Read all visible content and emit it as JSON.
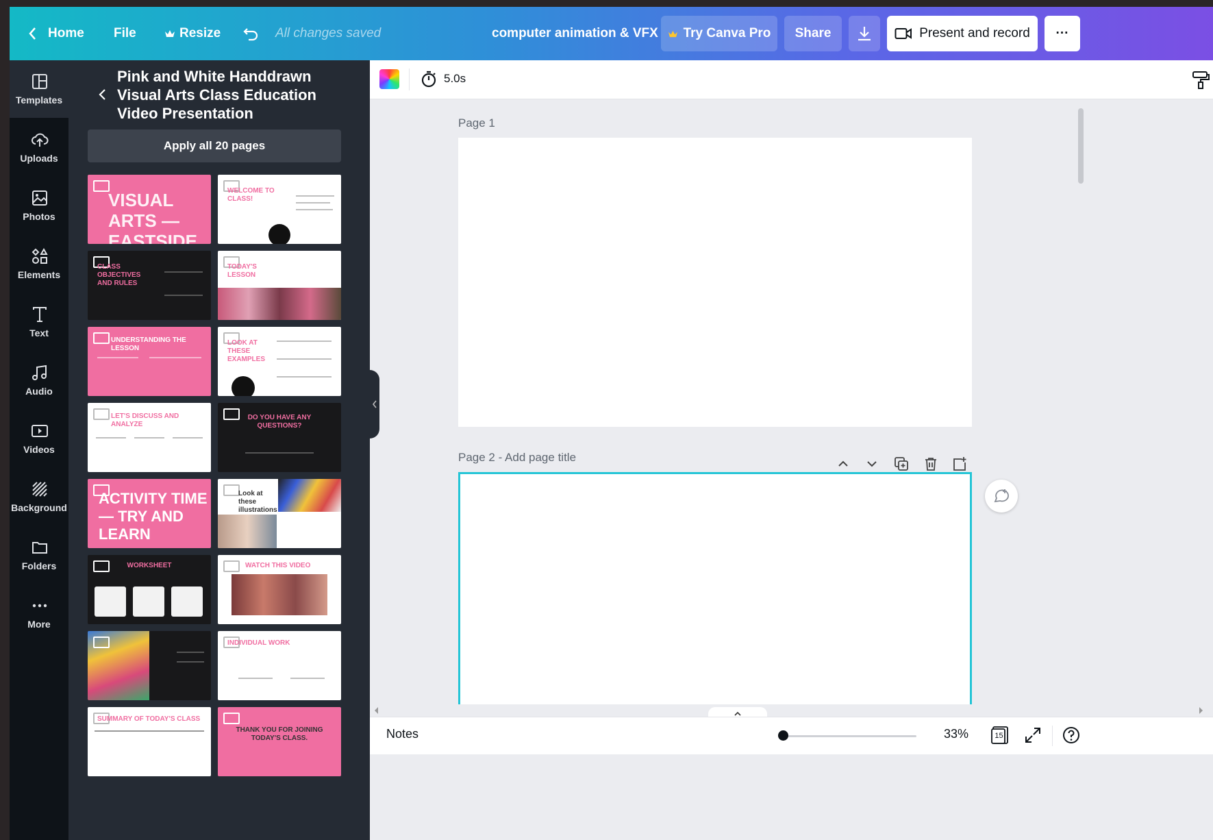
{
  "topbar": {
    "home_label": "Home",
    "file_label": "File",
    "resize_label": "Resize",
    "saved_status": "All changes saved",
    "doc_title": "computer animation & VFX",
    "try_pro_label": "Try Canva Pro",
    "share_label": "Share",
    "present_label": "Present and record",
    "more_label": "···"
  },
  "rail": {
    "items": [
      {
        "label": "Templates",
        "icon": "templates-icon"
      },
      {
        "label": "Uploads",
        "icon": "uploads-icon"
      },
      {
        "label": "Photos",
        "icon": "photos-icon"
      },
      {
        "label": "Elements",
        "icon": "elements-icon"
      },
      {
        "label": "Text",
        "icon": "text-icon"
      },
      {
        "label": "Audio",
        "icon": "audio-icon"
      },
      {
        "label": "Videos",
        "icon": "videos-icon"
      },
      {
        "label": "Background",
        "icon": "background-icon"
      },
      {
        "label": "Folders",
        "icon": "folders-icon"
      },
      {
        "label": "More",
        "icon": "more-icon"
      }
    ]
  },
  "panel": {
    "template_title": "Pink and White Handdrawn Visual Arts Class Education Video Presentation",
    "apply_label": "Apply all 20 pages",
    "thumbs": [
      {
        "text": "VISUAL ARTS — EASTSIDE LEARNING ACADEMY"
      },
      {
        "text": "WELCOME TO CLASS!"
      },
      {
        "text": "CLASS OBJECTIVES AND RULES"
      },
      {
        "text": "TODAY'S LESSON"
      },
      {
        "text": "UNDERSTANDING THE LESSON"
      },
      {
        "text": "LOOK AT THESE EXAMPLES"
      },
      {
        "text": "LET'S DISCUSS AND ANALYZE"
      },
      {
        "text": "DO YOU HAVE ANY QUESTIONS?"
      },
      {
        "text": "ACTIVITY TIME — TRY AND LEARN"
      },
      {
        "text": "Look at these illustrations"
      },
      {
        "text": "WORKSHEET"
      },
      {
        "text": "WATCH THIS VIDEO"
      },
      {
        "text": ""
      },
      {
        "text": "INDIVIDUAL WORK"
      },
      {
        "text": "SUMMARY OF TODAY'S CLASS"
      },
      {
        "text": "THANK YOU FOR JOINING TODAY'S CLASS."
      }
    ]
  },
  "editor": {
    "duration": "5.0s",
    "page1_label": "Page 1",
    "page2_label": "Page 2 - Add page title"
  },
  "bottombar": {
    "notes_label": "Notes",
    "zoom_value": "33%",
    "page_count": "15"
  },
  "colors": {
    "accent_teal": "#24c5d6",
    "template_pink": "#f06ea1",
    "rail_bg": "#0e1318",
    "panel_bg": "#252b34"
  }
}
